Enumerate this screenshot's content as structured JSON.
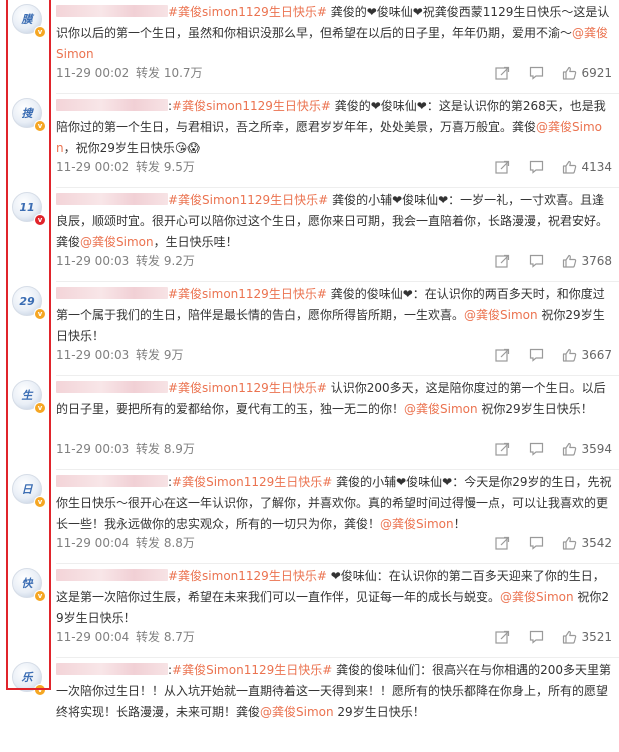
{
  "labels": {
    "repost_prefix": "转发"
  },
  "posts": [
    {
      "avatar_char": "膜",
      "badge": "gold",
      "colon": "",
      "hashtag": "#龚俊simon1129生日快乐#",
      "text": " 龚俊的❤俊味仙❤祝龚俊西蒙1129生日快乐～这是认识你以后的第一个生日，虽然和你相识没那么早，但希望在以后的日子里，年年仍期，爱用不渝～",
      "mention": "@龚俊Simon",
      "text_after": "",
      "time": "11-29 00:02",
      "reposts": "转发 10.7万",
      "likes": "6921"
    },
    {
      "avatar_char": "搜",
      "badge": "gold",
      "colon": ":",
      "hashtag": "#龚俊simon1129生日快乐#",
      "text": " 龚俊的❤俊味仙❤：这是认识你的第268天，也是我陪你过的第一个生日，与君相识，吾之所幸，愿君岁岁年年，处处美景，万喜万般宜。龚俊",
      "mention": "@龚俊Simon",
      "text_after": "，祝你29岁生日快乐😘😱",
      "time": "11-29 00:02",
      "reposts": "转发 9.5万",
      "likes": "4134"
    },
    {
      "avatar_char": "11",
      "badge": "red",
      "colon": "",
      "hashtag": "#龚俊Simon1129生日快乐#",
      "text": " 龚俊的小辅❤俊味仙❤：一岁一礼，一寸欢喜。且逢良辰，顺颂时宜。很开心可以陪你过这个生日，愿你来日可期，我会一直陪着你，长路漫漫，祝君安好。龚俊",
      "mention": "@龚俊Simon",
      "text_after": "，生日快乐哇！",
      "time": "11-29 00:03",
      "reposts": "转发 9.2万",
      "likes": "3768"
    },
    {
      "avatar_char": "29",
      "badge": "gold",
      "colon": "",
      "hashtag": "#龚俊simon1129生日快乐#",
      "text": " 龚俊的俊味仙❤：在认识你的两百多天时，和你度过第一个属于我们的生日，陪伴是最长情的告白，愿你所得皆所期，一生欢喜。",
      "mention": "@龚俊Simon",
      "text_after": " 祝你29岁生日快乐！",
      "time": "11-29 00:03",
      "reposts": "转发 9万",
      "likes": "3667"
    },
    {
      "avatar_char": "生",
      "badge": "gold",
      "colon": "",
      "hashtag": "#龚俊simon1129生日快乐#",
      "text": " 认识你200多天，这是陪你度过的第一个生日。以后的日子里，要把所有的爱都给你，夏代有工的玉，独一无二的你！",
      "mention": "@龚俊Simon",
      "text_after": " 祝你29岁生日快乐！",
      "time": "11-29 00:03",
      "reposts": "转发 8.9万",
      "likes": "3594"
    },
    {
      "avatar_char": "日",
      "badge": "gold",
      "colon": ":",
      "hashtag": "#龚俊Simon1129生日快乐#",
      "text": " 龚俊的小辅❤俊味仙❤：今天是你29岁的生日，先祝你生日快乐～很开心在这一年认识你，了解你，并喜欢你。真的希望时间过得慢一点，可以让我喜欢的更长一些！我永远做你的忠实观众，所有的一切只为你，龚俊！",
      "mention": "@龚俊Simon",
      "text_after": "！",
      "time": "11-29 00:04",
      "reposts": "转发 8.8万",
      "likes": "3542"
    },
    {
      "avatar_char": "快",
      "badge": "gold",
      "colon": "",
      "hashtag": "#龚俊simon1129生日快乐#",
      "text": " ❤俊味仙：在认识你的第二百多天迎来了你的生日，这是第一次陪你过生辰，希望在未来我们可以一直作伴，见证每一年的成长与蜕变。",
      "mention": "@龚俊Simon",
      "text_after": " 祝你29岁生日快乐！",
      "time": "11-29 00:04",
      "reposts": "转发 8.7万",
      "likes": "3521"
    },
    {
      "avatar_char": "乐",
      "badge": "gold",
      "colon": ":",
      "hashtag": "#龚俊Simon1129生日快乐#",
      "text": " 龚俊的俊味仙们：很高兴在与你相遇的200多天里第一次陪你过生日！！从入坑开始就一直期待着这一天得到来！！愿所有的快乐都降在你身上，所有的愿望终将实现！长路漫漫，未来可期！龚俊",
      "mention": "@龚俊Simon",
      "text_after": " 29岁生日快乐！",
      "time": "",
      "reposts": "",
      "likes": ""
    }
  ]
}
